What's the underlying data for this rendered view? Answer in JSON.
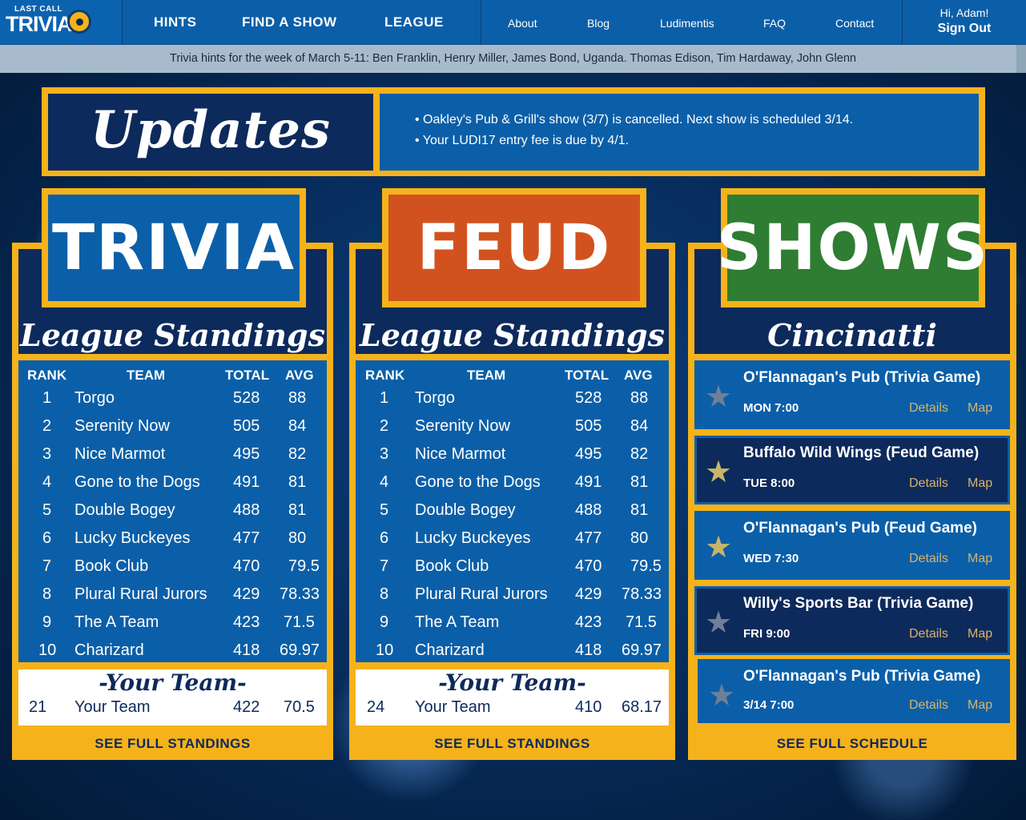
{
  "nav": {
    "logo_top": "LAST CALL",
    "logo_main": "TRIVIA",
    "main_links": [
      "HINTS",
      "FIND A SHOW",
      "LEAGUE"
    ],
    "sub_links": [
      "About",
      "Blog",
      "Ludimentis",
      "FAQ",
      "Contact"
    ],
    "greeting": "Hi, Adam!",
    "sign_out": "Sign Out"
  },
  "hints": "Trivia hints for the week of March 5-11: Ben Franklin, Henry Miller, James Bond, Uganda. Thomas Edison, Tim Hardaway, John Glenn",
  "updates": {
    "title": "Updates",
    "items": [
      "• Oakley's Pub & Grill's show (3/7) is cancelled. Next show is scheduled 3/14.",
      "• Your LUDI17 entry fee is due by 4/1."
    ]
  },
  "trivia": {
    "heading": "TRIVIA",
    "subtitle": "League Standings",
    "columns": [
      "RANK",
      "TEAM",
      "TOTAL",
      "AVG"
    ],
    "rows": [
      {
        "rank": "1",
        "team": "Torgo",
        "total": "528",
        "avg": "88"
      },
      {
        "rank": "2",
        "team": "Serenity Now",
        "total": "505",
        "avg": "84"
      },
      {
        "rank": "3",
        "team": "Nice Marmot",
        "total": "495",
        "avg": "82"
      },
      {
        "rank": "4",
        "team": "Gone to the Dogs",
        "total": "491",
        "avg": "81"
      },
      {
        "rank": "5",
        "team": "Double Bogey",
        "total": "488",
        "avg": "81"
      },
      {
        "rank": "6",
        "team": "Lucky Buckeyes",
        "total": "477",
        "avg": "80"
      },
      {
        "rank": "7",
        "team": "Book Club",
        "total": "470",
        "avg": "79.5"
      },
      {
        "rank": "8",
        "team": "Plural Rural Jurors",
        "total": "429",
        "avg": "78.33"
      },
      {
        "rank": "9",
        "team": "The A Team",
        "total": "423",
        "avg": "71.5"
      },
      {
        "rank": "10",
        "team": "Charizard",
        "total": "418",
        "avg": "69.97"
      }
    ],
    "your_team_title": "-Your Team-",
    "your_team": {
      "rank": "21",
      "team": "Your Team",
      "total": "422",
      "avg": "70.5"
    },
    "see_full": "SEE FULL STANDINGS",
    "tile_color": "#0b5fa8"
  },
  "feud": {
    "heading": "FEUD",
    "subtitle": "League Standings",
    "columns": [
      "RANK",
      "TEAM",
      "TOTAL",
      "AVG"
    ],
    "rows": [
      {
        "rank": "1",
        "team": "Torgo",
        "total": "528",
        "avg": "88"
      },
      {
        "rank": "2",
        "team": "Serenity Now",
        "total": "505",
        "avg": "84"
      },
      {
        "rank": "3",
        "team": "Nice Marmot",
        "total": "495",
        "avg": "82"
      },
      {
        "rank": "4",
        "team": "Gone to the Dogs",
        "total": "491",
        "avg": "81"
      },
      {
        "rank": "5",
        "team": "Double Bogey",
        "total": "488",
        "avg": "81"
      },
      {
        "rank": "6",
        "team": "Lucky Buckeyes",
        "total": "477",
        "avg": "80"
      },
      {
        "rank": "7",
        "team": "Book Club",
        "total": "470",
        "avg": "79.5"
      },
      {
        "rank": "8",
        "team": "Plural Rural Jurors",
        "total": "429",
        "avg": "78.33"
      },
      {
        "rank": "9",
        "team": "The A Team",
        "total": "423",
        "avg": "71.5"
      },
      {
        "rank": "10",
        "team": "Charizard",
        "total": "418",
        "avg": "69.97"
      }
    ],
    "your_team_title": "-Your Team-",
    "your_team": {
      "rank": "24",
      "team": "Your Team",
      "total": "410",
      "avg": "68.17"
    },
    "see_full": "SEE FULL STANDINGS",
    "tile_color": "#d2521f"
  },
  "shows": {
    "heading": "SHOWS",
    "subtitle": "Cincinatti",
    "tile_color": "#2e7d32",
    "items": [
      {
        "venue": "O'Flannagan's Pub (Trivia Game)",
        "when": "MON 7:00",
        "details": "Details",
        "map": "Map",
        "star": "grey",
        "bg": "#0b5fa8"
      },
      {
        "venue": "Buffalo Wild Wings (Feud Game)",
        "when": "TUE 8:00",
        "details": "Details",
        "map": "Map",
        "star": "gold",
        "bg": "#0d2a5c"
      },
      {
        "venue": "O'Flannagan's Pub (Feud Game)",
        "when": "WED 7:30",
        "details": "Details",
        "map": "Map",
        "star": "gold",
        "bg": "#0b5fa8"
      },
      {
        "venue": "Willy's Sports Bar (Trivia Game)",
        "when": "FRI 9:00",
        "details": "Details",
        "map": "Map",
        "star": "grey",
        "bg": "#0d2a5c"
      },
      {
        "venue": "O'Flannagan's Pub (Trivia Game)",
        "when": "3/14 7:00",
        "details": "Details",
        "map": "Map",
        "star": "grey",
        "bg": "#0b5fa8"
      }
    ],
    "see_full": "SEE FULL SCHEDULE"
  },
  "colors": {
    "accent_gold": "#f5b21b",
    "navy": "#0d2a5c",
    "blue": "#0b5fa8",
    "star_gold": "#c8b56a",
    "star_grey": "#6f7f97"
  }
}
